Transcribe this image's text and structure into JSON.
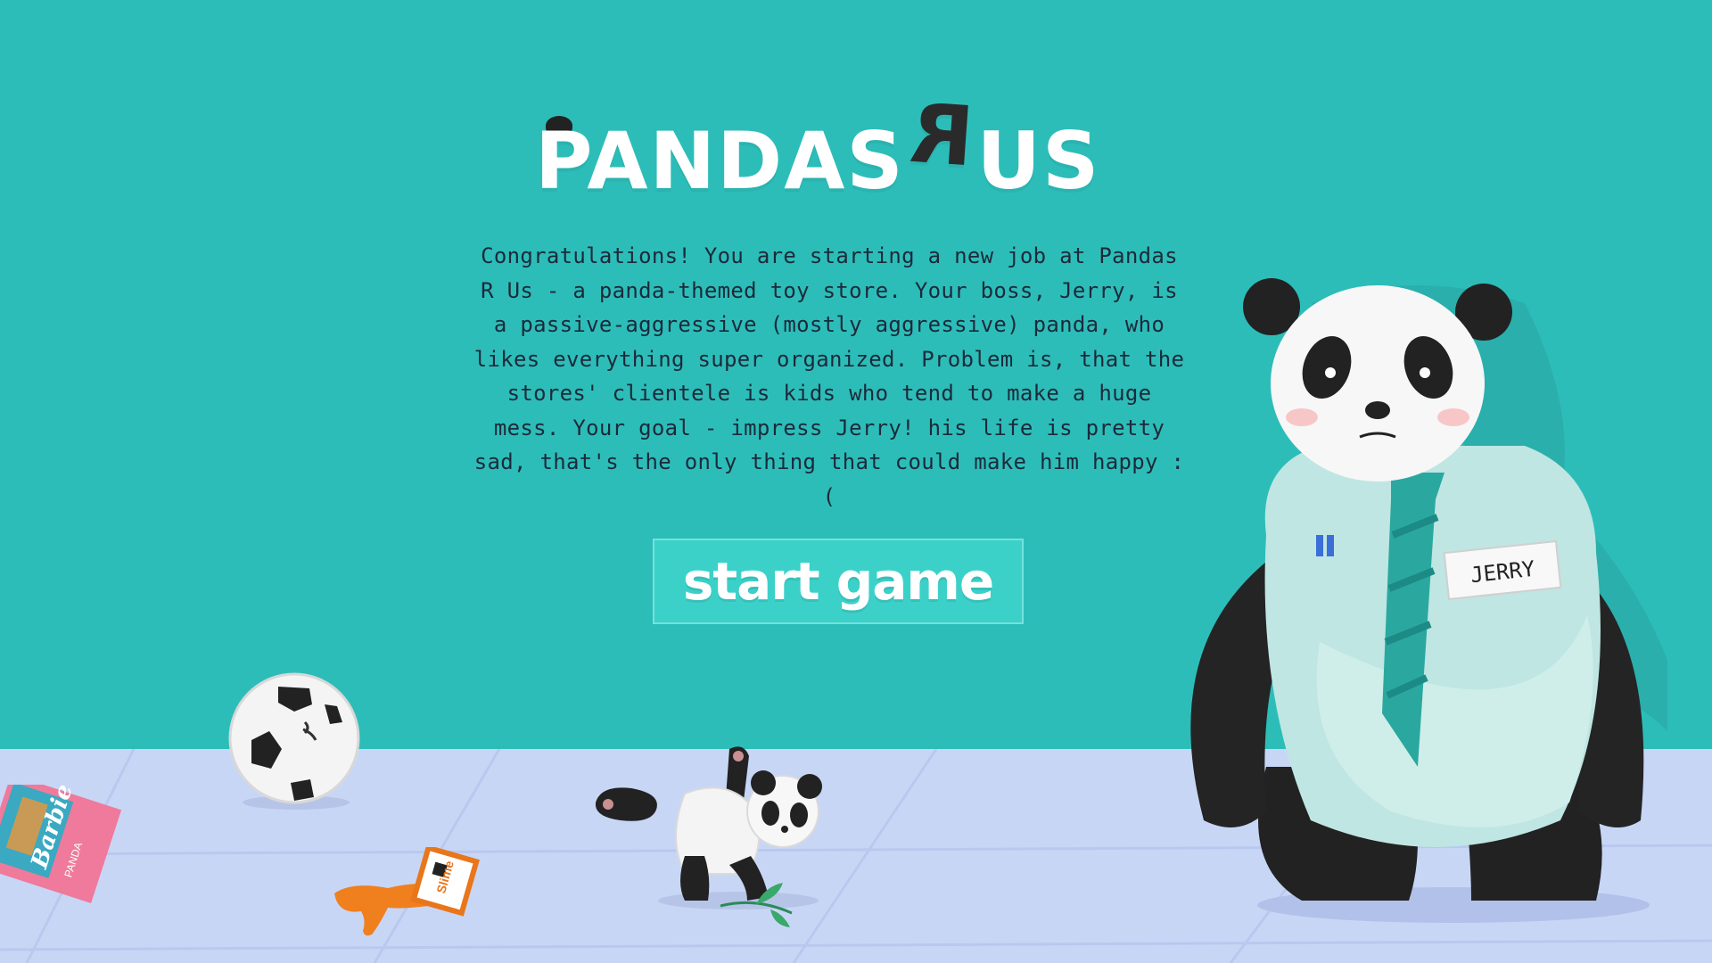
{
  "title": {
    "part1": "PANDAS",
    "part2": "R",
    "part3": "US"
  },
  "intro_text": "Congratulations! You are starting a new job at Pandas R Us - a panda-themed toy store. Your boss, Jerry, is a passive-aggressive (mostly aggressive) panda, who likes everything super organized. Problem is, that the stores' clientele is kids who tend to make a huge mess. Your goal - impress Jerry! his life is pretty sad, that's the only thing that could make him happy :(",
  "start_button_label": "start game",
  "jerry": {
    "name_tag": "JERRY"
  },
  "toys": {
    "barbie_brand": "Barbie",
    "barbie_sub": "PANDA",
    "slime_label": "Slime"
  },
  "colors": {
    "background": "#2dbdb9",
    "floor": "#c8d6f6",
    "button": "#3bd1c9",
    "shirt": "#bfe6e2",
    "tie": "#2aa8a0"
  }
}
